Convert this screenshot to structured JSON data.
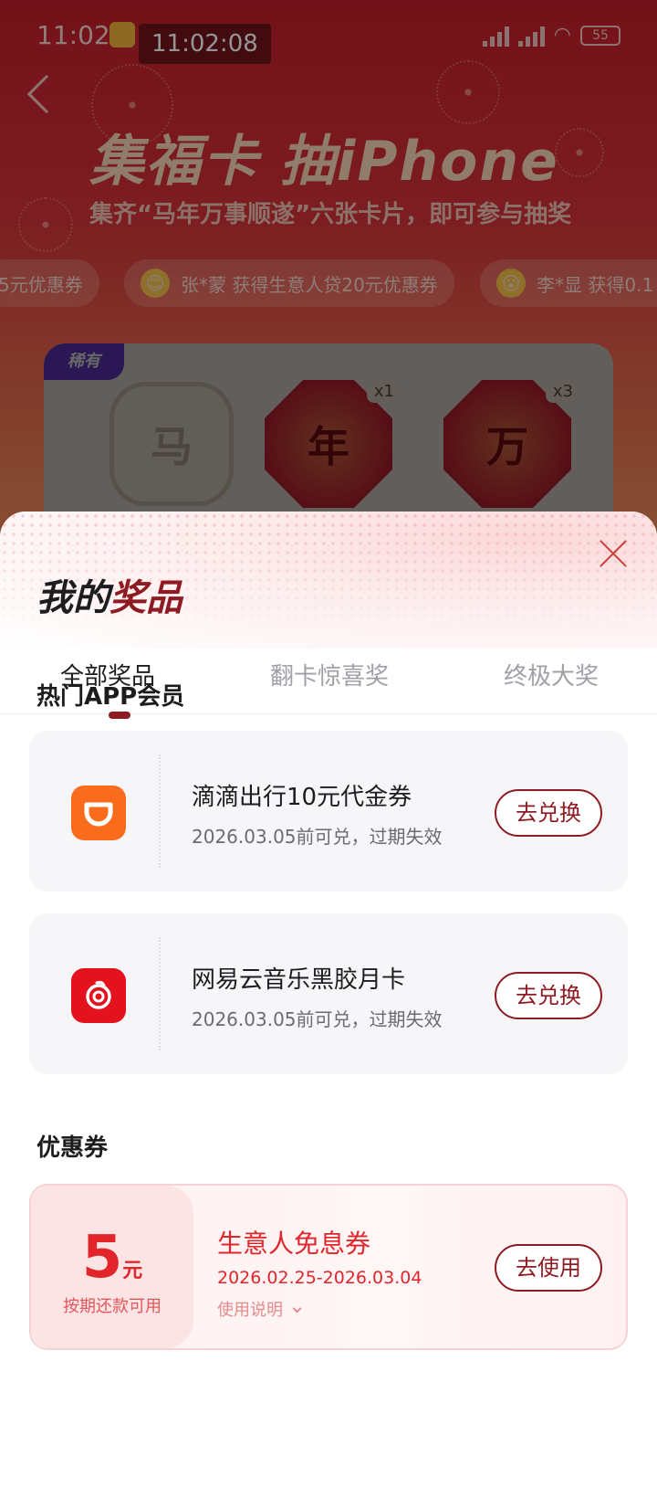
{
  "status_bar": {
    "time": "11:02",
    "clock_overlay": "11:02:08",
    "network_badges": [
      "HD",
      "HD"
    ],
    "battery": "55"
  },
  "hero": {
    "title": "集福卡 抽iPhone",
    "subtitle": "集齐“马年万事顺遂”六张卡片，即可参与抽奖"
  },
  "ticker": [
    {
      "text": "5元优惠券",
      "avatar": ""
    },
    {
      "text": "张*蒙 获得生意人贷20元优惠券",
      "avatar": "😊"
    },
    {
      "text": "李*显 获得0.1",
      "avatar": "😮"
    }
  ],
  "cards": {
    "rare_tag": "稀有",
    "items": [
      {
        "char": "马",
        "count": ""
      },
      {
        "char": "年",
        "count": "x1"
      },
      {
        "char": "万",
        "count": "x3"
      }
    ]
  },
  "sheet": {
    "title_part1": "我的",
    "title_part2": "奖品",
    "tabs": [
      {
        "label": "全部奖品",
        "active": true
      },
      {
        "label": "翻卡惊喜奖",
        "active": false
      },
      {
        "label": "终极大奖",
        "active": false
      }
    ],
    "hot_section_title": "热门APP会员",
    "prizes": [
      {
        "name": "滴滴出行10元代金券",
        "expiry": "2026.03.05前可兑，过期失效",
        "button": "去兑换",
        "logo": "didi-logo"
      },
      {
        "name": "网易云音乐黑胶月卡",
        "expiry": "2026.03.05前可兑，过期失效",
        "button": "去兑换",
        "logo": "netease-music-logo"
      }
    ],
    "coupon_section_title": "优惠券",
    "coupon": {
      "amount": "5",
      "unit": "元",
      "condition": "按期还款可用",
      "name": "生意人免息券",
      "date_range": "2026.02.25-2026.03.04",
      "note": "使用说明",
      "button": "去使用"
    }
  },
  "colors": {
    "brand_dark_red": "#8e1a22",
    "coupon_red": "#e2252b",
    "didi_orange": "#fb6b1c",
    "netease_red": "#e3121c"
  }
}
